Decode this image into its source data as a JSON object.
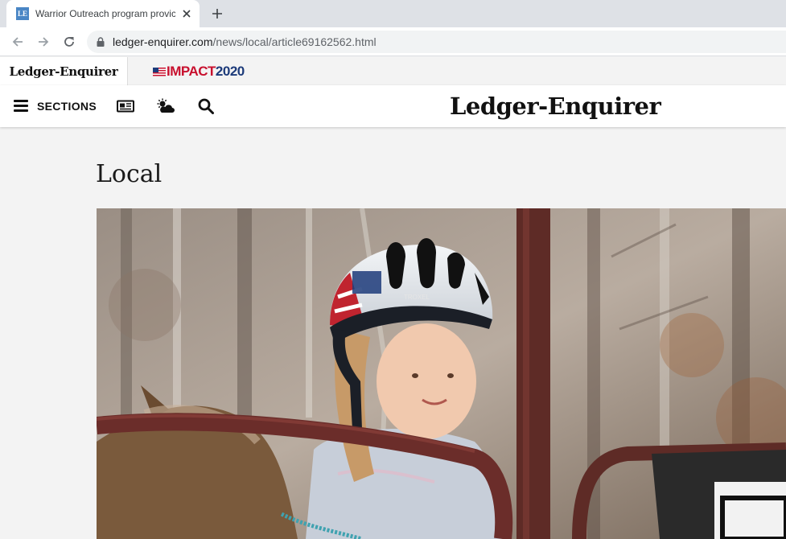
{
  "browser": {
    "tab_title": "Warrior Outreach program provic",
    "favicon_text": "LE",
    "url_host": "ledger-enquirer.com",
    "url_path": "/news/local/article69162562.html"
  },
  "utility": {
    "home_logo": "Ledger-Enquirer",
    "impact_part1": "IMPACT",
    "impact_part2": "2020"
  },
  "header": {
    "sections_label": "SECTIONS",
    "masthead": "Ledger-Enquirer",
    "icons": [
      "menu-icon",
      "newspaper-icon",
      "weather-icon",
      "search-icon"
    ]
  },
  "main": {
    "section_title": "Local"
  },
  "hero_image": {
    "helmet_label": "TROXEL"
  },
  "colors": {
    "impact_red": "#c8102e",
    "impact_blue": "#1d3b7a",
    "page_bg": "#f3f3f3"
  }
}
